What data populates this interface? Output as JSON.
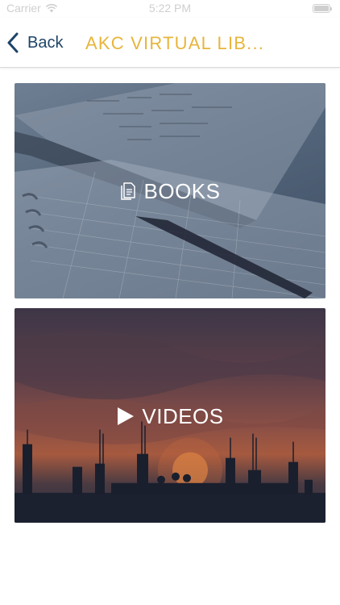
{
  "status_bar": {
    "carrier": "Carrier",
    "time": "5:22 PM"
  },
  "nav": {
    "back_label": "Back",
    "title": "AKC VIRTUAL LIB..."
  },
  "cards": {
    "books": {
      "label": "BOOKS",
      "icon": "document-icon"
    },
    "videos": {
      "label": "VIDEOS",
      "icon": "play-icon"
    }
  },
  "colors": {
    "title_accent": "#e8b53b",
    "back_tint": "#1e4468"
  }
}
